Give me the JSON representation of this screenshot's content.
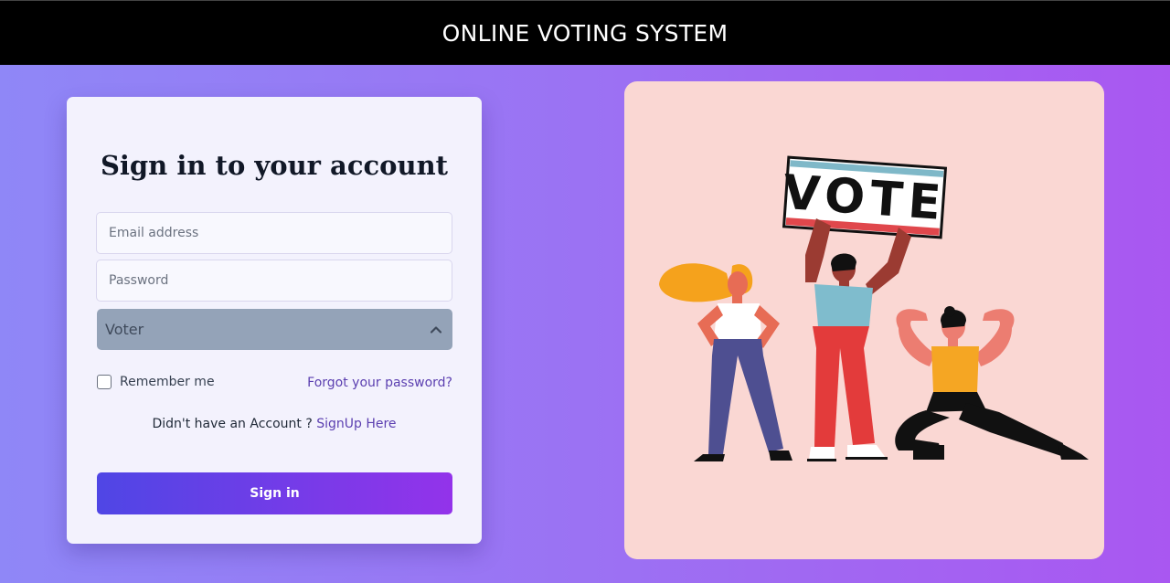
{
  "header": {
    "title": "ONLINE VOTING SYSTEM"
  },
  "login": {
    "title": "Sign in to your account",
    "email_placeholder": "Email address",
    "password_placeholder": "Password",
    "role_selected": "Voter",
    "remember_label": "Remember me",
    "forgot_label": "Forgot your password?",
    "signup_prompt": "Didn't have an Account ? ",
    "signup_link": "SignUp Here",
    "signin_label": "Sign in"
  },
  "illustration": {
    "sign_text": "VOTE"
  },
  "colors": {
    "accent": "#5b3fb0",
    "button_start": "#4f46e5",
    "button_end": "#9333ea",
    "select_bg": "#94a3b8",
    "illustration_bg": "#fad7d3",
    "topbar_bg": "#000000"
  },
  "icons": {
    "select_chevron": "chevron-up-icon"
  }
}
